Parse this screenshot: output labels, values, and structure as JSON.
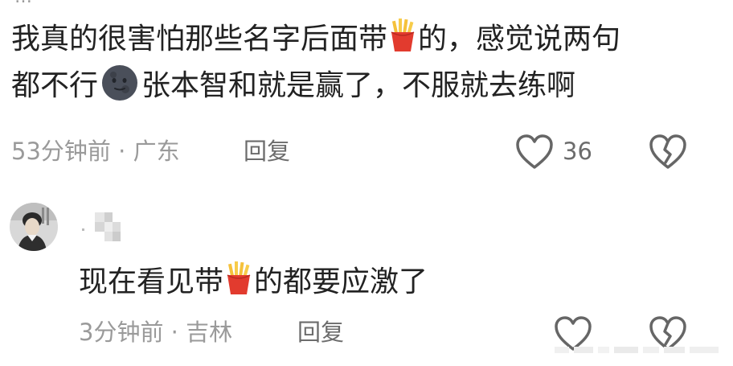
{
  "header_clip": {
    "partial_text": "…"
  },
  "comment1": {
    "line1_a": "我真的很害怕那些名字后面带",
    "line1_emoji": "fries-emoji",
    "line1_b": "的，感觉说两句",
    "line2_a": "都不行",
    "line2_emoji": "new-moon-face-emoji",
    "line2_b": "张本智和就是赢了，不服就去练啊",
    "time": "53分钟前",
    "separator": "·",
    "location": "广东",
    "reply_label": "回复",
    "like_count": "36"
  },
  "comment2": {
    "text_a": "现在看见带",
    "text_emoji": "fries-emoji",
    "text_b": "的都要应激了",
    "time": "3分钟前",
    "separator": "·",
    "location": "吉林",
    "reply_label": "回复",
    "like_count": ""
  },
  "icons": {
    "like": "heart-outline-icon",
    "dislike": "broken-heart-outline-icon",
    "icon_color": "#666666"
  },
  "colors": {
    "text": "#222222",
    "meta": "#9a9a9a",
    "action": "#6c6c6c",
    "background": "#ffffff"
  }
}
